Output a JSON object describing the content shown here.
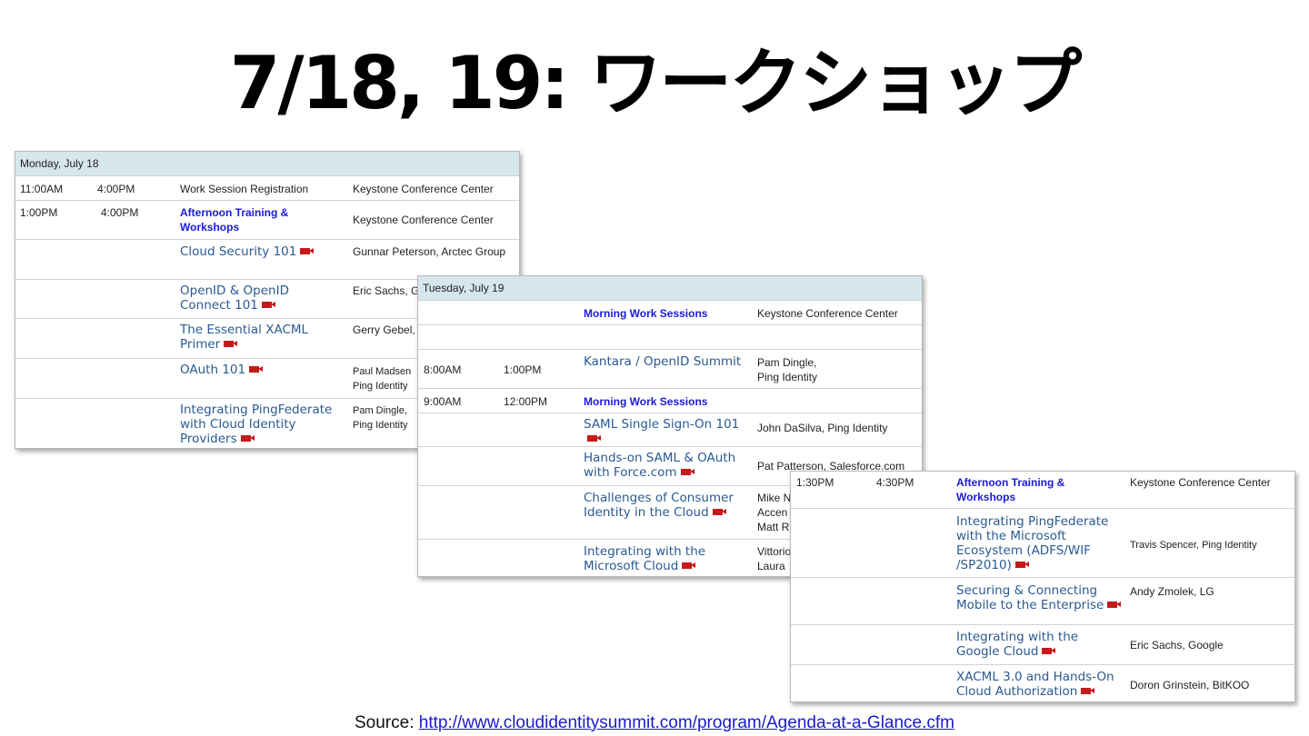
{
  "title": "7/18, 19: ワークショップ",
  "monday": {
    "header": "Monday, July 18",
    "rows": [
      {
        "start": "11:00AM",
        "end": "4:00PM",
        "event": "Work Session Registration",
        "location": "Keystone Conference Center"
      },
      {
        "start": "1:00PM",
        "end": "4:00PM",
        "event": "Afternoon Training & Workshops",
        "location": "Keystone Conference Center"
      },
      {
        "session": "Cloud Security 101",
        "speaker": "Gunnar Peterson, Arctec Group"
      },
      {
        "session": "OpenID & OpenID Connect 101",
        "speaker": "Eric Sachs, G"
      },
      {
        "session": "The Essential XACML Primer",
        "speaker": "Gerry Gebel,"
      },
      {
        "session": "OAuth 101",
        "speaker": "Paul Madsen Ping Identity"
      },
      {
        "session": "Integrating PingFederate with Cloud Identity Providers",
        "speaker": "Pam Dingle, Ping Identity"
      }
    ]
  },
  "tuesday": {
    "header": "Tuesday, July 19",
    "rows": [
      {
        "event": "Morning Work Sessions",
        "location": "Keystone Conference Center"
      },
      {
        "start": "8:00AM",
        "end": "1:00PM",
        "session": "Kantara / OpenID Summit",
        "speaker": "Pam Dingle, Ping Identity"
      },
      {
        "start": "9:00AM",
        "end": "12:00PM",
        "event": "Morning Work Sessions"
      },
      {
        "session": "SAML Single Sign-On 101",
        "speaker": "John DaSilva, Ping Identity"
      },
      {
        "session": "Hands-on SAML & OAuth with Force.com",
        "speaker": "Pat Patterson, Salesforce.com"
      },
      {
        "session": "Challenges of Consumer Identity in the Cloud",
        "speaker": "Mike N Accen Matt R"
      },
      {
        "session": "Integrating with the Microsoft Cloud",
        "speaker": "Vittorio Laura"
      }
    ]
  },
  "afternoon": {
    "rows": [
      {
        "start": "1:30PM",
        "end": "4:30PM",
        "event": "Afternoon Training & Workshops",
        "location": "Keystone Conference Center"
      },
      {
        "session": "Integrating PingFederate with the Microsoft Ecosystem (ADFS/WIF /SP2010)",
        "speaker": "Travis Spencer, Ping Identity"
      },
      {
        "session": "Securing & Connecting Mobile to the Enterprise",
        "speaker": "Andy Zmolek, LG"
      },
      {
        "session": "Integrating with the Google Cloud",
        "speaker": "Eric Sachs, Google"
      },
      {
        "session": "XACML 3.0 and Hands-On Cloud Authorization",
        "speaker": "Doron Grinstein, BitKOO"
      }
    ]
  },
  "source": {
    "label": "Source: ",
    "url": "http://www.cloudidentitysummit.com/program/Agenda-at-a-Glance.cfm"
  },
  "colors": {
    "header_bg": "#d6e6ed",
    "event_blue": "#1a1adb",
    "session_blue": "#2a5a92",
    "camera_red": "#c41a1a"
  },
  "icons": {
    "video": "video-camera-icon"
  }
}
